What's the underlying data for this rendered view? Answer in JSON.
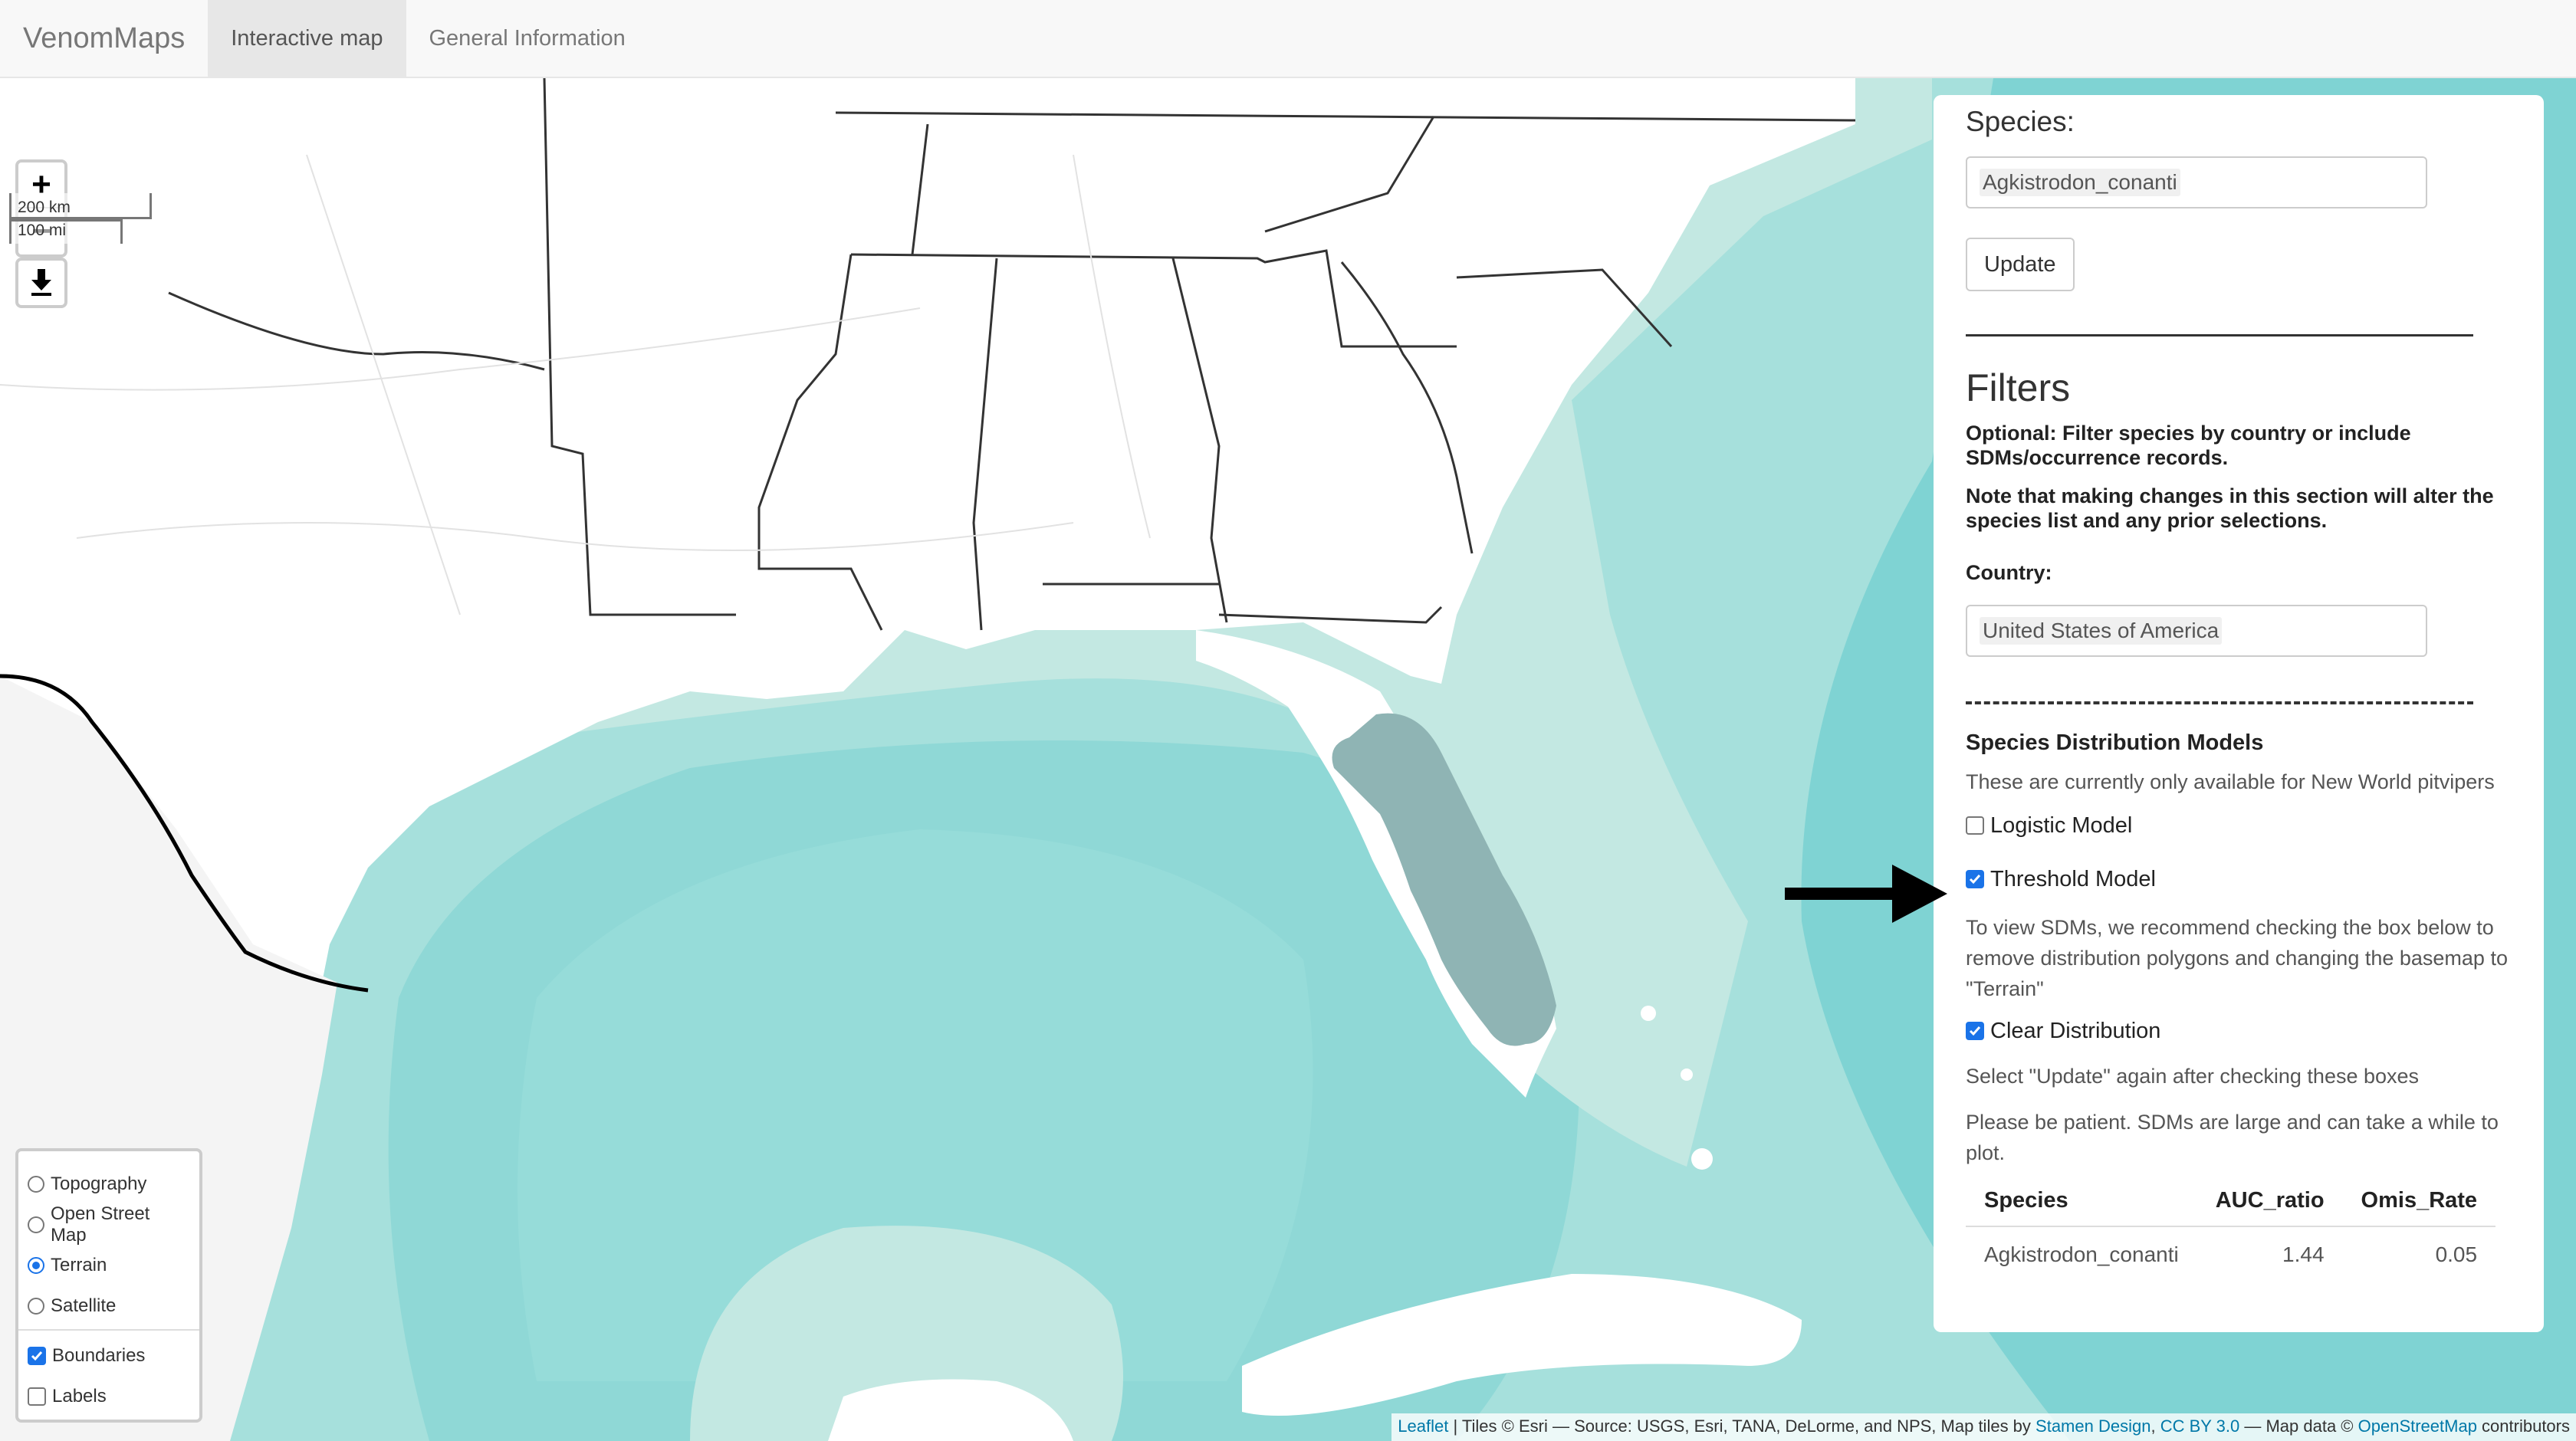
{
  "navbar": {
    "brand": "VenomMaps",
    "tabs": [
      {
        "label": "Interactive map",
        "active": true
      },
      {
        "label": "General Information",
        "active": false
      }
    ]
  },
  "map_controls": {
    "zoom_in": "+",
    "zoom_out": "−",
    "scale_km": "200 km",
    "scale_mi": "100 mi",
    "download_icon": "download-icon"
  },
  "layers": {
    "basemaps": [
      {
        "label": "Topography",
        "selected": false
      },
      {
        "label": "Open Street Map",
        "selected": false
      },
      {
        "label": "Terrain",
        "selected": true
      },
      {
        "label": "Satellite",
        "selected": false
      }
    ],
    "overlays": [
      {
        "label": "Boundaries",
        "checked": true
      },
      {
        "label": "Labels",
        "checked": false
      }
    ]
  },
  "attribution": {
    "leaflet": "Leaflet",
    "tiles_text": " | Tiles © Esri — Source: USGS, Esri, TANA, DeLorme, and NPS, Map tiles by ",
    "stamen": "Stamen Design",
    "sep": ", ",
    "ccby": "CC BY 3.0",
    "mapdata": " — Map data © ",
    "osm": "OpenStreetMap",
    "contrib": " contributors"
  },
  "panel": {
    "species_label": "Species:",
    "species_value": "Agkistrodon_conanti",
    "update_button": "Update",
    "filters_heading": "Filters",
    "filters_note1": "Optional: Filter species by country or include SDMs/occurrence records.",
    "filters_note2": "Note that making changes in this section will alter the species list and any prior selections.",
    "country_label": "Country:",
    "country_value": "United States of America",
    "sdm_heading": "Species Distribution Models",
    "sdm_availability": "These are currently only available for New World pitvipers",
    "logistic_model": {
      "label": "Logistic Model",
      "checked": false
    },
    "threshold_model": {
      "label": "Threshold Model",
      "checked": true
    },
    "sdm_recommendation": "To view SDMs, we recommend checking the box below to remove distribution polygons and changing the basemap to \"Terrain\"",
    "clear_distribution": {
      "label": "Clear Distribution",
      "checked": true
    },
    "update_again": "Select \"Update\" again after checking these boxes",
    "patience": "Please be patient. SDMs are large and can take a while to plot.",
    "table": {
      "headers": [
        "Species",
        "AUC_ratio",
        "Omis_Rate"
      ],
      "rows": [
        [
          "Agkistrodon_conanti",
          "1.44",
          "0.05"
        ]
      ]
    }
  },
  "colors": {
    "ocean_shallow": "#c3e8e2",
    "ocean_mid": "#a6e0dc",
    "ocean_deep": "#8fd8d6",
    "land": "#ffffff",
    "sdm_fill": "#8fb4b4",
    "accent_checkbox": "#1a73e8"
  }
}
